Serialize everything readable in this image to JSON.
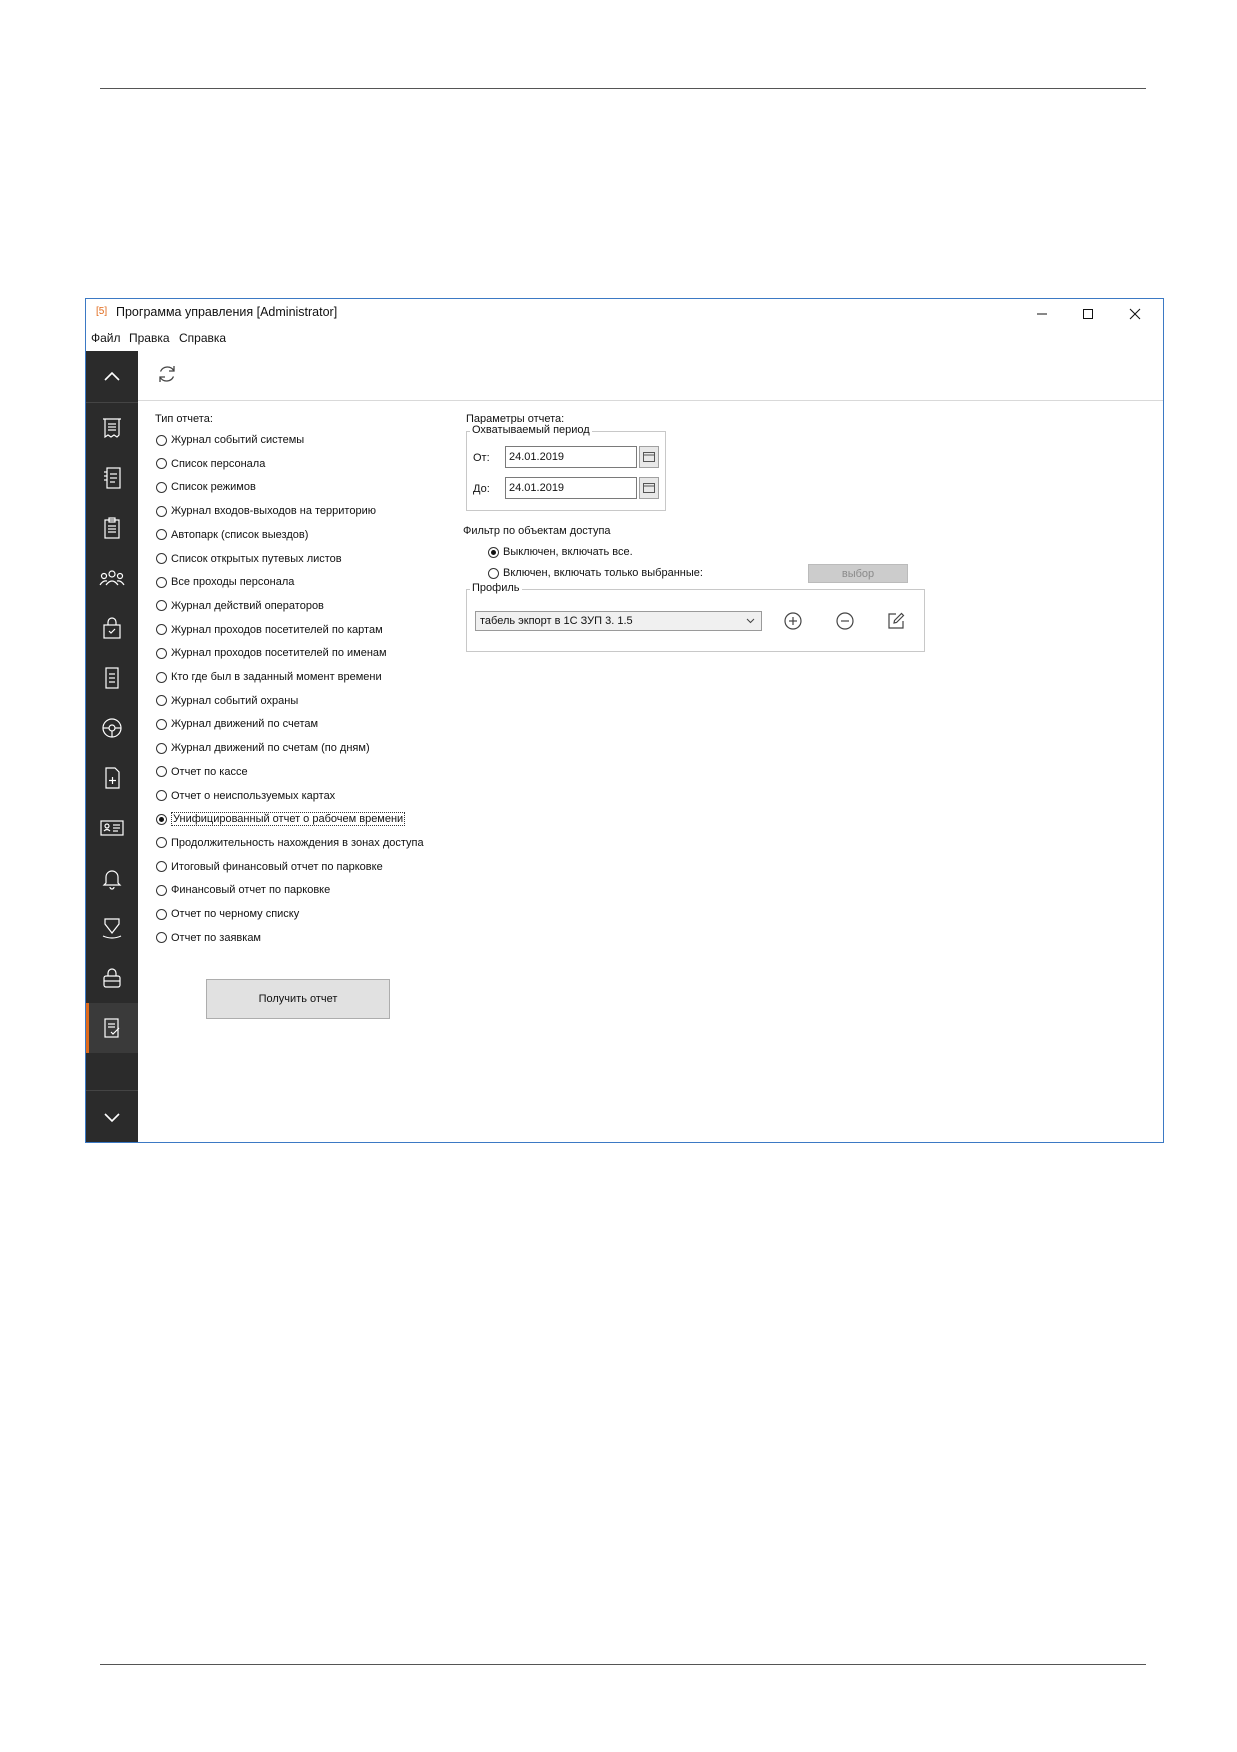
{
  "window": {
    "logo_text": "[5]",
    "title": "Программа управления [Administrator]"
  },
  "menu": [
    "Файл",
    "Правка",
    "Справка"
  ],
  "rail": {
    "icons": [
      "events-log-icon",
      "document-list-icon",
      "clipboard-icon",
      "people-icon",
      "access-lock-icon",
      "document-icon",
      "steering-wheel-icon",
      "document-add-icon",
      "id-card-icon",
      "bell-icon",
      "location-pin-icon",
      "lock-icon",
      "reports-icon"
    ],
    "active": "reports-icon"
  },
  "left": {
    "heading": "Тип отчета:",
    "options": [
      "Журнал событий системы",
      "Список персонала",
      "Список режимов",
      "Журнал входов-выходов на территорию",
      "Автопарк (список выездов)",
      "Список открытых путевых листов",
      "Все проходы персонала",
      "Журнал действий операторов",
      "Журнал проходов посетителей по картам",
      "Журнал проходов посетителей по именам",
      "Кто где был в заданный момент времени",
      "Журнал событий охраны",
      "Журнал движений по счетам",
      "Журнал движений по счетам (по дням)",
      "Отчет по кассе",
      "Отчет о неиспользуемых картах",
      "Унифицированный отчет о рабочем времени",
      "Продолжительность нахождения в зонах доступа",
      "Итоговый финансовый отчет по парковке",
      "Финансовый отчет по парковке",
      "Отчет по черному списку",
      "Отчет по заявкам"
    ],
    "selected_index": 16,
    "get_report_label": "Получить отчет"
  },
  "right": {
    "heading": "Параметры отчета:",
    "period": {
      "title": "Охватываемый период",
      "from_label": "От:",
      "from_value": "24.01.2019",
      "to_label": "До:",
      "to_value": "24.01.2019"
    },
    "filter": {
      "title": "Фильтр по объектам доступа",
      "opt_off": "Выключен, включать все.",
      "opt_on": "Включен, включать только выбранные:",
      "selected": "off",
      "choose_label": "выбор"
    },
    "profile": {
      "title": "Профиль",
      "value": "табель экпорт в 1С ЗУП 3. 1.5"
    }
  }
}
